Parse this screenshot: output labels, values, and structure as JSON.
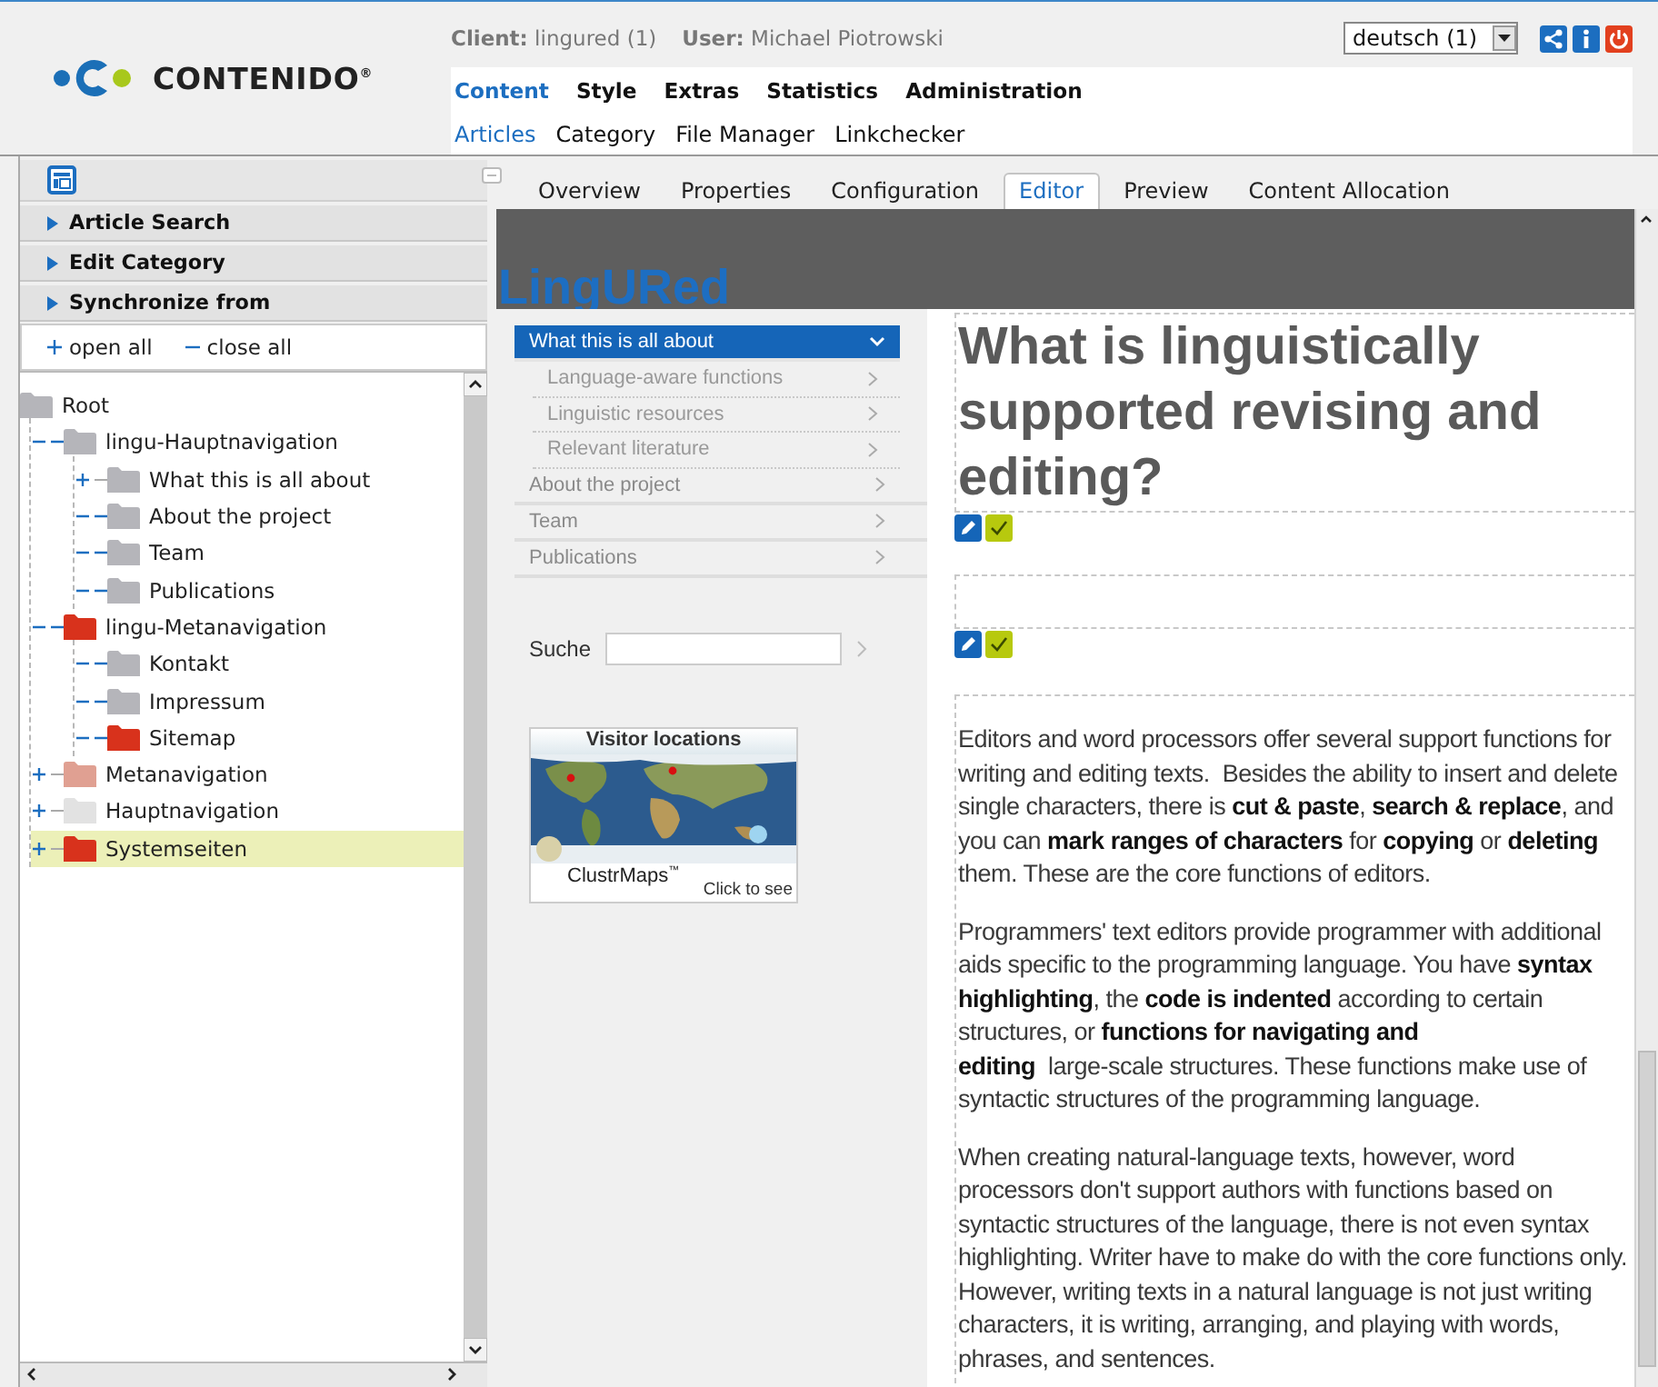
{
  "header": {
    "logo": "CONTENIDO$^{®}$",
    "client_label": "Client:",
    "client": "lingured (1)",
    "user_label": "User:",
    "user": "Michael Piotrowski",
    "language": "deutsch (1)"
  },
  "main_menu": [
    {
      "label": "Content",
      "selected": true
    },
    {
      "label": "Style",
      "selected": false
    },
    {
      "label": "Extras",
      "selected": false
    },
    {
      "label": "Statistics",
      "selected": false
    },
    {
      "label": "Administration",
      "selected": false
    }
  ],
  "sub_menu": [
    {
      "label": "Articles",
      "selected": true
    },
    {
      "label": "Category",
      "selected": false
    },
    {
      "label": "File Manager",
      "selected": false
    },
    {
      "label": "Linkchecker",
      "selected": false
    }
  ],
  "sidebar": {
    "sections": [
      {
        "label": "Article Search",
        "expanded": false
      },
      {
        "label": "Edit Category",
        "expanded": false
      },
      {
        "label": "Synchronize from",
        "expanded": false
      }
    ],
    "open_all": "open all",
    "close_all": "close all",
    "tree": [
      {
        "label": "Root",
        "color": "#b5b5ba",
        "selected": false,
        "children": [
          {
            "label": "lingu-Hauptnavigation",
            "color": "#b5b5ba",
            "selected": false,
            "expanded": true,
            "children": [
              {
                "label": "What this is all about",
                "color": "#b5b5ba",
                "selected": false,
                "expanded": false
              },
              {
                "label": "About the project",
                "color": "#b5b5ba",
                "selected": false,
                "expanded": true
              },
              {
                "label": "Team",
                "color": "#b5b5ba",
                "selected": false,
                "expanded": true
              },
              {
                "label": "Publications",
                "color": "#b5b5ba",
                "selected": false,
                "expanded": true
              }
            ]
          },
          {
            "label": "lingu-Metanavigation",
            "color": "#d8321c",
            "selected": false,
            "expanded": true,
            "children": [
              {
                "label": "Kontakt",
                "color": "#b5b5ba",
                "selected": false,
                "expanded": true
              },
              {
                "label": "Impressum",
                "color": "#b5b5ba",
                "selected": false,
                "expanded": true
              },
              {
                "label": "Sitemap",
                "color": "#d8321c",
                "selected": false,
                "expanded": true
              }
            ]
          },
          {
            "label": "Metanavigation",
            "color": "#e0a092",
            "selected": false,
            "expanded": false
          },
          {
            "label": "Hauptnavigation",
            "color": "#e2e2e2",
            "selected": false,
            "expanded": false
          },
          {
            "label": "Systemseiten",
            "color": "#d8321c",
            "selected": true,
            "expanded": false
          }
        ]
      }
    ]
  },
  "tabs": [
    {
      "label": "Overview",
      "selected": false
    },
    {
      "label": "Properties",
      "selected": false
    },
    {
      "label": "Configuration",
      "selected": false
    },
    {
      "label": "Editor",
      "selected": true
    },
    {
      "label": "Preview",
      "selected": false
    },
    {
      "label": "Content Allocation",
      "selected": false
    }
  ],
  "preview": {
    "site_title": "LingURed",
    "navigation": [
      {
        "label": "What this is all about",
        "selected": true,
        "children": [
          {
            "label": "Language-aware functions",
            "selected": false
          },
          {
            "label": "Linguistic resources",
            "selected": false
          },
          {
            "label": "Relevant literature",
            "selected": false
          }
        ]
      },
      {
        "label": "About the project",
        "selected": false
      },
      {
        "label": "Team",
        "selected": false
      },
      {
        "label": "Publications",
        "selected": false
      }
    ],
    "search_label": "Suche",
    "widget": {
      "title": "Visitor locations",
      "brand": "ClustrMaps$^{™}$",
      "link": "Click to see"
    },
    "heading": "What is linguistically supported revising and editing?",
    "paragraphs": [
      "Editors and word processors offer several support functions for writing and editing texts.  Besides the ability to insert and delete single characters, there is **cut & paste**, **search & replace**, and you can **mark ranges of characters** for **copying** or **deleting** them. These are the core functions of editors.",
      "Programmers' text editors provide programmer with additional aids specific to the programming language. You have **syntax highlighting**, the **code is indented** according to certain structures, or **functions for navigating and\nediting**  large-scale structures. These functions make use of syntactic structures of the programming language.",
      "When creating natural-language texts, however, word processors don't support authors with functions based on syntactic structures of the language, there is not even syntax highlighting. Writer have to make do with the core functions only. However, writing texts in a natural language is not just writing characters, it is writing, arranging, and playing with words, phrases, and sentences."
    ]
  }
}
